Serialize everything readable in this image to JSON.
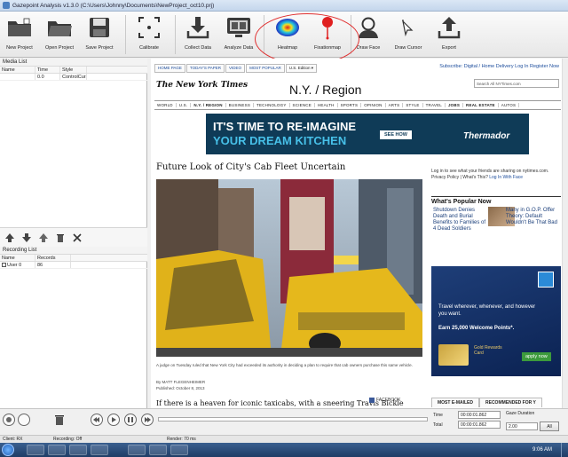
{
  "window": {
    "title": "Gazepoint Analysis v1.3.0 (C:\\Users\\Johnny\\Documents\\NewProject_oct10.prj)"
  },
  "toolbar": {
    "new_project": "New Project",
    "open_project": "Open Project",
    "save_project": "Save Project",
    "calibrate": "Calibrate",
    "collect_data": "Collect Data",
    "analyze_data": "Analyze Data",
    "heatmap": "Heatmap",
    "fixationmap": "Fixationmap",
    "draw_face": "Draw Face",
    "draw_cursor": "Draw Cursor",
    "export": "Export"
  },
  "media_list": {
    "title": "Media List",
    "columns": [
      "Name",
      "Time",
      "Style"
    ],
    "rows": [
      {
        "name": "",
        "time": "0.0",
        "style": "ControlCurs"
      }
    ]
  },
  "recording_list": {
    "title": "Recording List",
    "columns": [
      "Name",
      "Records"
    ],
    "rows": [
      {
        "name": "User 0",
        "records": "86"
      }
    ]
  },
  "web": {
    "top_tabs": [
      "HOME PAGE",
      "TODAY'S PAPER",
      "VIDEO",
      "MOST POPULAR",
      "U.S. Edition ▾"
    ],
    "top_links": "Subscribe: Digital / Home Delivery   Log In   Register Now",
    "logo": "The New York Times",
    "section": "N.Y. / Region",
    "search_placeholder": "Search All NYTimes.com",
    "nav": [
      "WORLD",
      "U.S.",
      "N.Y. / REGION",
      "BUSINESS",
      "TECHNOLOGY",
      "SCIENCE",
      "HEALTH",
      "SPORTS",
      "OPINION",
      "ARTS",
      "STYLE",
      "TRAVEL",
      "JOBS",
      "REAL ESTATE",
      "AUTOS"
    ],
    "ad": {
      "line1": "IT'S TIME TO RE-IMAGINE",
      "line2": "YOUR DREAM KITCHEN",
      "cta": "SEE HOW",
      "brand": "Thermador"
    },
    "headline": "Future Look of City's Cab Fleet Uncertain",
    "caption": "A judge on Tuesday ruled that New York City had exceeded its authority in deciding a plan to require that cab owners purchase this same vehicle.",
    "photo_credit": "Fred R. Conrad/The New York Times",
    "byline": "By MATT FLEGENHEIMER",
    "published": "Published: October 8, 2013",
    "lede": "If there is a heaven for iconic taxicabs, with a sneering Travis Bickle",
    "facebook": "FACEBOOK",
    "social_text": "Log in to see what your friends are sharing on nytimes.com. Privacy Policy | What's This?",
    "social_link": "Log In With Face",
    "popular_title": "What's Popular Now",
    "popular1": "Shutdown Denies Death and Burial Benefits to Families of 4 Dead Soldiers",
    "popular2": "Many in G.O.P. Offer Theory: Default Wouldn't Be That Bad",
    "amex": {
      "line1": "Travel wherever, whenever, and however you want.",
      "line2": "Earn 25,000 Welcome Points*.",
      "card": "Gold Rewards Card",
      "cta": "apply now"
    },
    "tab_most_emailed": "MOST E-MAILED",
    "tab_recommended": "RECOMMENDED FOR Y"
  },
  "playback": {
    "time_label": "Time",
    "total_label": "Total",
    "time_value": "00:00:01.862",
    "total_value": "00:00:01.862",
    "gaze_duration_label": "Gaze Duration",
    "gaze_duration_value": "2.00",
    "all_button": "All"
  },
  "status": {
    "client": "Client: RX",
    "recording": "Recording: Off",
    "render": "Render: 70 ms"
  },
  "taskbar": {
    "time": "9:06 AM"
  }
}
